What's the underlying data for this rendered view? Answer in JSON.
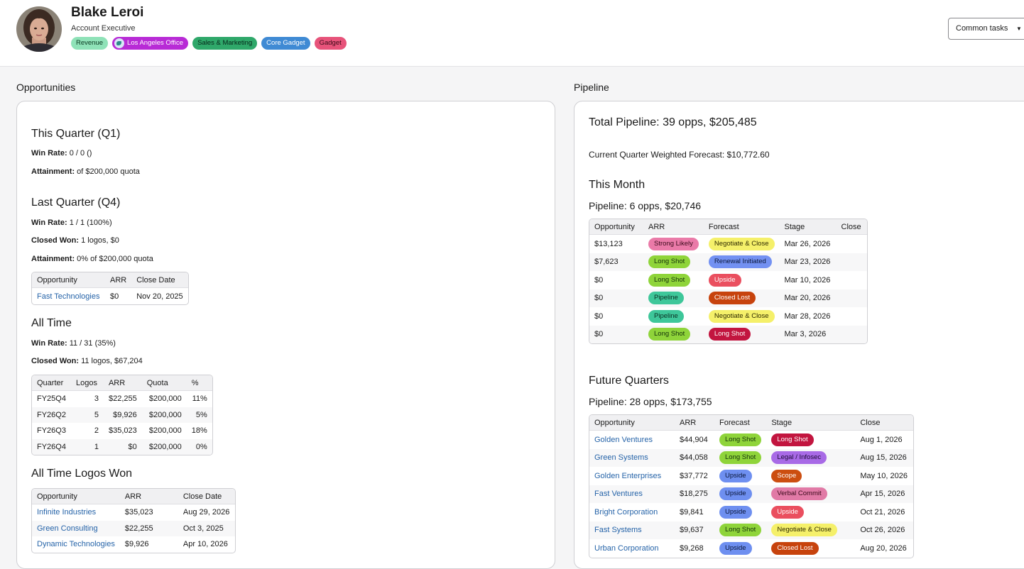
{
  "profile": {
    "name": "Blake Leroi",
    "title": "Account Executive",
    "tags": [
      {
        "label": "Revenue",
        "bg": "#8fe2b8",
        "fg": "#0b3a22"
      },
      {
        "label": "Los Angeles Office",
        "bg": "#b82bd6",
        "fg": "#ffffff"
      },
      {
        "label": "Sales & Marketing",
        "bg": "#2fa86a",
        "fg": "#06271a"
      },
      {
        "label": "Core Gadget",
        "bg": "#3f8ad4",
        "fg": "#ffffff"
      },
      {
        "label": "Gadget",
        "bg": "#e7537a",
        "fg": "#3a0a17"
      }
    ],
    "common_tasks_label": "Common tasks"
  },
  "opportunities": {
    "section_title": "Opportunities",
    "this_quarter": {
      "heading": "This Quarter (Q1)",
      "win_rate_label": "Win Rate:",
      "win_rate_value": "0 / 0 ()",
      "attainment_label": "Attainment:",
      "attainment_value": "of $200,000 quota"
    },
    "last_quarter": {
      "heading": "Last Quarter (Q4)",
      "win_rate_label": "Win Rate:",
      "win_rate_value": "1 / 1 (100%)",
      "closed_won_label": "Closed Won:",
      "closed_won_value": "1 logos, $0",
      "attainment_label": "Attainment:",
      "attainment_value": "0% of $200,000 quota",
      "table": {
        "headers": [
          "Opportunity",
          "ARR",
          "Close Date"
        ],
        "rows": [
          [
            "Fast Technologies",
            "$0",
            "Nov 20, 2025"
          ]
        ]
      }
    },
    "all_time": {
      "heading": "All Time",
      "win_rate_label": "Win Rate:",
      "win_rate_value": "11 / 31 (35%)",
      "closed_won_label": "Closed Won:",
      "closed_won_value": "11 logos, $67,204",
      "table": {
        "headers": [
          "Quarter",
          "Logos",
          "ARR",
          "Quota",
          "%"
        ],
        "rows": [
          [
            "FY25Q4",
            "3",
            "$22,255",
            "$200,000",
            "11%"
          ],
          [
            "FY26Q2",
            "5",
            "$9,926",
            "$200,000",
            "5%"
          ],
          [
            "FY26Q3",
            "2",
            "$35,023",
            "$200,000",
            "18%"
          ],
          [
            "FY26Q4",
            "1",
            "$0",
            "$200,000",
            "0%"
          ]
        ]
      }
    },
    "logos_won": {
      "heading": "All Time Logos Won",
      "table": {
        "headers": [
          "Opportunity",
          "ARR",
          "Close Date"
        ],
        "rows": [
          [
            "Infinite Industries",
            "$35,023",
            "Aug 29, 2026"
          ],
          [
            "Green Consulting",
            "$22,255",
            "Oct 3, 2025"
          ],
          [
            "Dynamic Technologies",
            "$9,926",
            "Apr 10, 2026"
          ]
        ]
      }
    }
  },
  "pipeline": {
    "section_title": "Pipeline",
    "total": "Total Pipeline: 39 opps, $205,485",
    "weighted": "Current Quarter Weighted Forecast: $10,772.60",
    "this_month": {
      "heading": "This Month",
      "summary": "Pipeline: 6 opps, $20,746",
      "headers": [
        "Opportunity",
        "ARR",
        "Forecast",
        "Stage",
        "Close"
      ],
      "rows": [
        {
          "arr": "$13,123",
          "forecast": "Strong Likely",
          "stage": "Negotiate & Close",
          "close": "Mar 26, 2026"
        },
        {
          "arr": "$7,623",
          "forecast": "Long Shot",
          "stage": "Renewal Initiated",
          "close": "Mar 23, 2026"
        },
        {
          "arr": "$0",
          "forecast": "Long Shot",
          "stage": "Upside",
          "close": "Mar 10, 2026"
        },
        {
          "arr": "$0",
          "forecast": "Pipeline",
          "stage": "Closed Lost",
          "close": "Mar 20, 2026"
        },
        {
          "arr": "$0",
          "forecast": "Pipeline",
          "stage": "Negotiate & Close",
          "close": "Mar 28, 2026"
        },
        {
          "arr": "$0",
          "forecast": "Long Shot",
          "stage": "Long Shot",
          "close": "Mar 3, 2026"
        }
      ]
    },
    "future": {
      "heading": "Future Quarters",
      "summary": "Pipeline: 28 opps, $173,755",
      "headers": [
        "Opportunity",
        "ARR",
        "Forecast",
        "Stage",
        "Close"
      ],
      "rows": [
        {
          "name": "Golden Ventures",
          "arr": "$44,904",
          "forecast": "Long Shot",
          "stage": "Long Shot",
          "close": "Aug 1, 2026"
        },
        {
          "name": "Green Systems",
          "arr": "$44,058",
          "forecast": "Long Shot",
          "stage": "Legal / Infosec",
          "close": "Aug 15, 2026"
        },
        {
          "name": "Golden Enterprises",
          "arr": "$37,772",
          "forecast": "Upside",
          "stage": "Scope",
          "close": "May 10, 2026"
        },
        {
          "name": "Fast Ventures",
          "arr": "$18,275",
          "forecast": "Upside",
          "stage": "Verbal Commit",
          "close": "Apr 15, 2026"
        },
        {
          "name": "Bright Corporation",
          "arr": "$9,841",
          "forecast": "Upside",
          "stage": "Upside",
          "close": "Oct 21, 2026"
        },
        {
          "name": "Fast Systems",
          "arr": "$9,637",
          "forecast": "Long Shot",
          "stage": "Negotiate & Close",
          "close": "Oct 26, 2026"
        },
        {
          "name": "Urban Corporation",
          "arr": "$9,268",
          "forecast": "Upside",
          "stage": "Closed Lost",
          "close": "Aug 20, 2026"
        }
      ]
    }
  },
  "pill_colors": {
    "Strong Likely": {
      "bg": "#ea7aa8",
      "fg": "#3a0a1a"
    },
    "Long Shot (forecast)": {
      "bg": "#8fd43a",
      "fg": "#12300a"
    },
    "Pipeline": {
      "bg": "#3ec79a",
      "fg": "#0a2e22"
    },
    "Upside (forecast)": {
      "bg": "#6e8ff0",
      "fg": "#0a1638"
    },
    "Negotiate & Close": {
      "bg": "#f5f06a",
      "fg": "#2e2a00"
    },
    "Renewal Initiated": {
      "bg": "#7391f2",
      "fg": "#0a1638"
    },
    "Upside (stage)": {
      "bg": "#ea4f5f",
      "fg": "#ffffff"
    },
    "Closed Lost": {
      "bg": "#c7430d",
      "fg": "#ffffff"
    },
    "Long Shot (stage)": {
      "bg": "#c2153f",
      "fg": "#ffffff"
    },
    "Legal / Infosec": {
      "bg": "#a86ae6",
      "fg": "#1e0a38"
    },
    "Scope": {
      "bg": "#cc4e10",
      "fg": "#ffffff"
    },
    "Verbal Commit": {
      "bg": "#e17aa6",
      "fg": "#3a0a1a"
    }
  }
}
